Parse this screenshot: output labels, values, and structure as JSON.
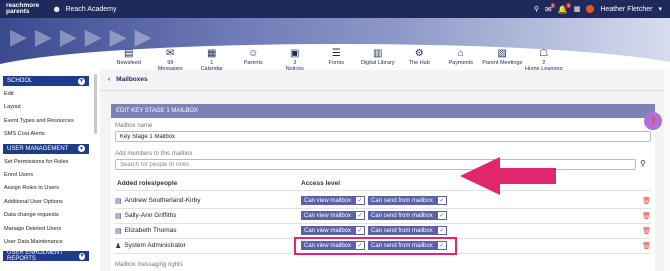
{
  "topbar": {
    "logo_line1": "reachmore",
    "logo_line2": "parents",
    "school_name": "Reach Academy",
    "user_name": "Heather Fletcher",
    "notif_badge_1": "1",
    "notif_badge_2": "1",
    "apps_label": "▦"
  },
  "nav": {
    "items": [
      {
        "label": "Newsfeed",
        "icon": "newsfeed-icon",
        "glyph": "▤"
      },
      {
        "label": "Messages",
        "icon": "messages-icon",
        "glyph": "✉",
        "count": "99"
      },
      {
        "label": "Calendar",
        "icon": "calendar-icon",
        "glyph": "▦",
        "count": "1"
      },
      {
        "label": "Parents",
        "icon": "parents-icon",
        "glyph": "☺"
      },
      {
        "label": "Notices",
        "icon": "notices-icon",
        "glyph": "▣",
        "count": "3"
      },
      {
        "label": "Forms",
        "icon": "forms-icon",
        "glyph": "☰"
      },
      {
        "label": "Digital Library",
        "icon": "library-icon",
        "glyph": "▥"
      },
      {
        "label": "The Hub",
        "icon": "hub-icon",
        "glyph": "⚙"
      },
      {
        "label": "Payments",
        "icon": "payments-icon",
        "glyph": "⌂"
      },
      {
        "label": "Parent Meetings",
        "icon": "meetings-icon",
        "glyph": "▧"
      },
      {
        "label": "Home Learning",
        "icon": "home-learning-icon",
        "glyph": "☖",
        "count": "2"
      }
    ]
  },
  "sidebar": {
    "school_header": "SCHOOL",
    "school_items": [
      "Edit",
      "Layout",
      "Event Types and Resources",
      "SMS Cost Alerts"
    ],
    "user_mgmt_header": "USER MANAGEMENT",
    "user_mgmt_items": [
      "Set Permissions for Roles",
      "Enrol Users",
      "Assign Roles to Users",
      "Additional User Options",
      "Data change requests",
      "Manage Deleted Users",
      "User Data Maintenance"
    ],
    "enrolment_header": "USER ENROLMENT REPORTS"
  },
  "breadcrumb": {
    "back": "‹",
    "title": "Mailboxes"
  },
  "panel": {
    "heading": "EDIT KEY STAGE 1 MAILBOX",
    "mailbox_name_label": "Mailbox name",
    "mailbox_name_value": "Key Stage 1 Mailbox",
    "add_members_label": "Add members to this mailbox",
    "search_placeholder": "Search for people or roles",
    "col_roles": "Added roles/people",
    "col_access": "Access level",
    "rows": [
      {
        "name": "Andrew Southerland-Kirby",
        "icon": "person-card-icon",
        "view": "Can view mailbox",
        "send": "Can send from mailbox"
      },
      {
        "name": "Sally-Ann Griffiths",
        "icon": "person-card-icon",
        "view": "Can view mailbox",
        "send": "Can send from mailbox"
      },
      {
        "name": "Elizabeth Thomas",
        "icon": "person-card-icon",
        "view": "Can view mailbox",
        "send": "Can send from mailbox"
      },
      {
        "name": "System Administrator",
        "icon": "group-icon",
        "view": "Can view mailbox",
        "send": "Can send from mailbox"
      }
    ],
    "footer_label": "Mailbox messaging rights"
  },
  "colors": {
    "accent": "#1f2a5c",
    "pill": "#5a61a6",
    "highlight": "#e2266e",
    "delete": "#e53935"
  }
}
